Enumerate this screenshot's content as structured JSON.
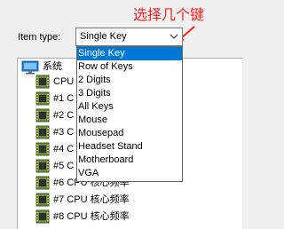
{
  "annotation": {
    "text": "选择几个键",
    "color": "#ff2020"
  },
  "item_type": {
    "label": "Item type:",
    "selected": "Single Key",
    "options": [
      "Single Key",
      "Row of Keys",
      "2 Digits",
      "3 Digits",
      "All Keys",
      "Mouse",
      "Mousepad",
      "Headset Stand",
      "Motherboard",
      "VGA"
    ],
    "highlight_color": "#0078d7"
  },
  "tree": {
    "root": {
      "label": "系统",
      "icon": "monitor-icon"
    },
    "rows": [
      {
        "label": "CPU",
        "icon": "chip-icon"
      },
      {
        "label": "#1 C",
        "icon": "chip-icon"
      },
      {
        "label": "#2 C",
        "icon": "chip-icon"
      },
      {
        "label": "#3 C",
        "icon": "chip-icon"
      },
      {
        "label": "#4 C",
        "icon": "chip-icon"
      },
      {
        "label": "#5 C",
        "icon": "chip-icon"
      },
      {
        "label": "#6 CPU 核心频率",
        "icon": "chip-icon"
      },
      {
        "label": "#7 CPU 核心频率",
        "icon": "chip-icon"
      },
      {
        "label": "#8 CPU 核心频率",
        "icon": "chip-icon"
      }
    ]
  }
}
